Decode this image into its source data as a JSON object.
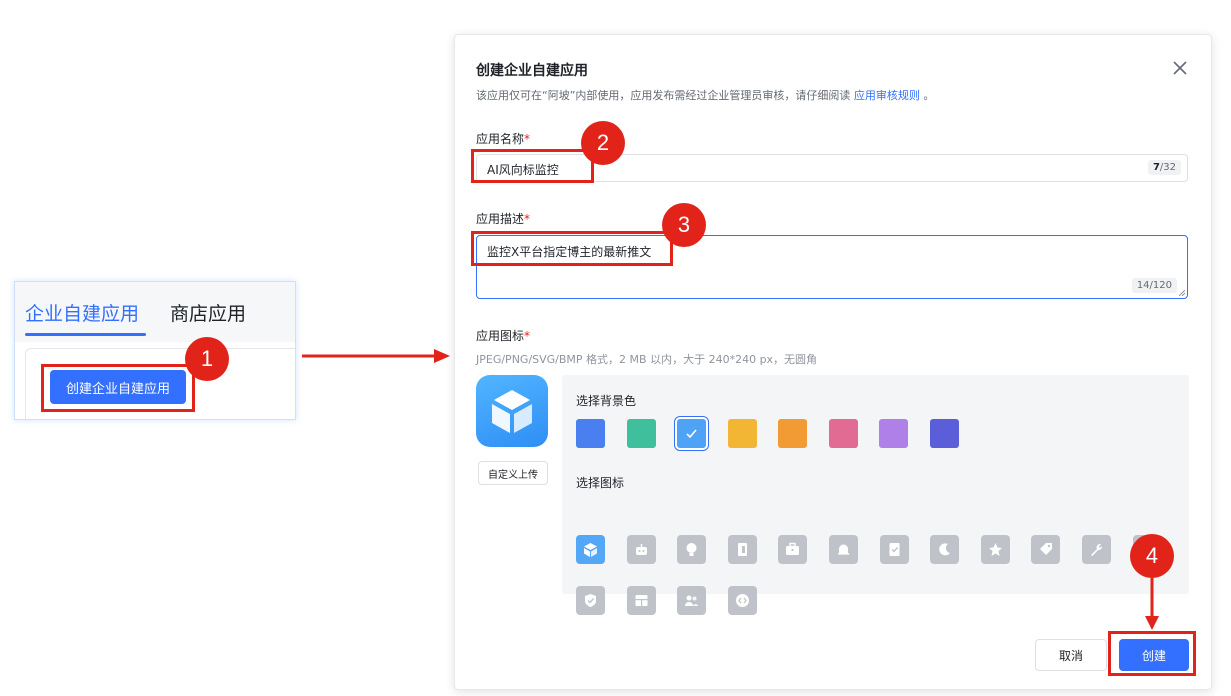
{
  "left_panel": {
    "tabs": [
      "企业自建应用",
      "商店应用"
    ],
    "create_button_label": "创建企业自建应用"
  },
  "annotations": {
    "steps": [
      "1",
      "2",
      "3",
      "4"
    ]
  },
  "dialog": {
    "title": "创建企业自建应用",
    "subtitle_text": "该应用仅可在“阿坡”内部使用，应用发布需经过企业管理员审核，请仔细阅读",
    "subtitle_link": "应用审核规则",
    "subtitle_end": "。",
    "name_field": {
      "label": "应用名称",
      "required_mark": "*",
      "value": "AI风向标监控",
      "count_current": "7",
      "count_max": "/32"
    },
    "desc_field": {
      "label": "应用描述",
      "required_mark": "*",
      "value": "监控X平台指定博主的最新推文",
      "count": "14/120"
    },
    "icon_field": {
      "label": "应用图标",
      "required_mark": "*",
      "hint": "JPEG/PNG/SVG/BMP 格式，2 MB 以内，大于 240*240 px，无圆角",
      "upload_label": "自定义上传",
      "bg_color_label": "选择背景色",
      "colors": [
        "#4a7ff0",
        "#3fbf9b",
        "#4fa3f7",
        "#f2b534",
        "#f29a33",
        "#e16b93",
        "#b080e9",
        "#5a5fd9"
      ],
      "selected_color_index": 2,
      "icon_label": "选择图标",
      "icons": [
        "cube-icon",
        "robot-icon",
        "bulb-icon",
        "book-icon",
        "briefcase-icon",
        "bell-icon",
        "bookmark-check-icon",
        "moon-icon",
        "star-icon",
        "tag-icon",
        "wrench-icon",
        "document-icon",
        "shield-check-icon",
        "layout-icon",
        "people-icon",
        "code-icon"
      ],
      "selected_icon_index": 0
    },
    "cancel_label": "取消",
    "create_label": "创建"
  }
}
